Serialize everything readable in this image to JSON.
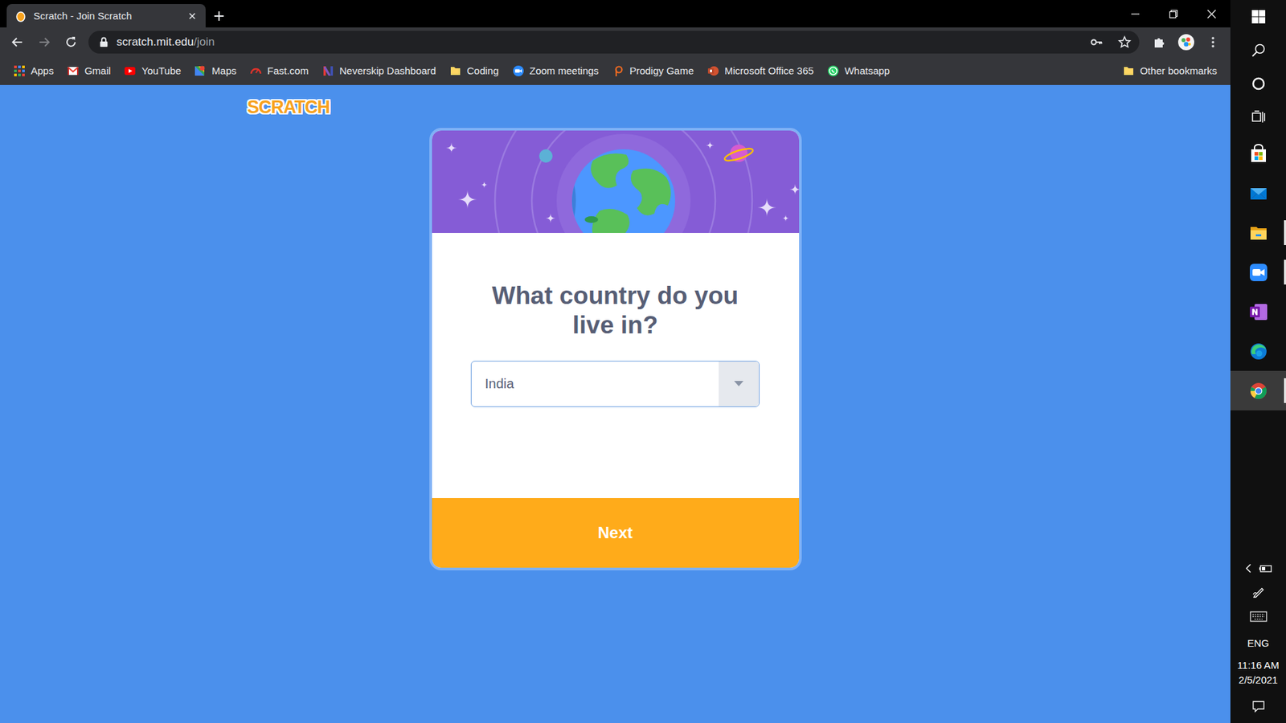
{
  "browser": {
    "tab_title": "Scratch - Join Scratch",
    "url": {
      "host": "scratch.mit.edu",
      "path": "/join"
    }
  },
  "bookmarks": [
    {
      "label": "Apps",
      "kind": "apps"
    },
    {
      "label": "Gmail",
      "kind": "gmail"
    },
    {
      "label": "YouTube",
      "kind": "youtube"
    },
    {
      "label": "Maps",
      "kind": "maps"
    },
    {
      "label": "Fast.com",
      "kind": "fast"
    },
    {
      "label": "Neverskip Dashboard",
      "kind": "neverskip"
    },
    {
      "label": "Coding",
      "kind": "folder"
    },
    {
      "label": "Zoom meetings",
      "kind": "zoom"
    },
    {
      "label": "Prodigy Game",
      "kind": "prodigy"
    },
    {
      "label": "Microsoft Office 365",
      "kind": "office"
    },
    {
      "label": "Whatsapp",
      "kind": "whatsapp"
    }
  ],
  "other_bookmarks": "Other bookmarks",
  "page": {
    "logo": "SCRATCH",
    "heading": "What country do you live in?",
    "country": "India",
    "button": "Next"
  },
  "taskbar": {
    "apps": [
      {
        "kind": "store",
        "running": false,
        "selected": false
      },
      {
        "kind": "mail",
        "running": false,
        "selected": false
      },
      {
        "kind": "files",
        "running": true,
        "selected": false
      },
      {
        "kind": "zoom",
        "running": true,
        "selected": false
      },
      {
        "kind": "onenote",
        "running": false,
        "selected": false
      },
      {
        "kind": "edge",
        "running": false,
        "selected": false
      },
      {
        "kind": "chrome",
        "running": true,
        "selected": true
      }
    ],
    "language": "ENG",
    "time": "11:16 AM",
    "date": "2/5/2021"
  }
}
